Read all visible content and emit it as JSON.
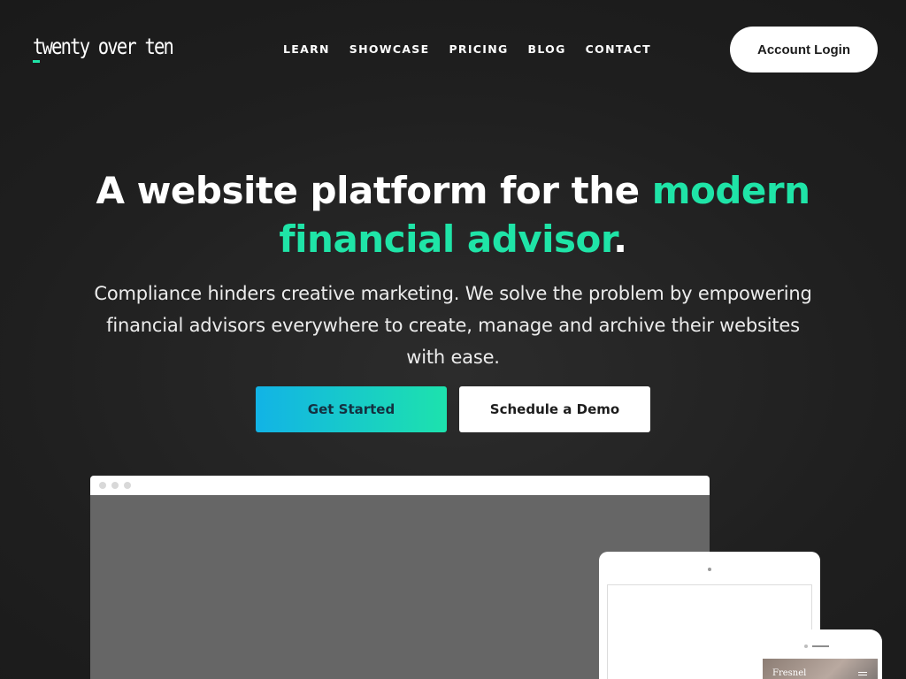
{
  "brand": {
    "logo_text": "twenty over ten",
    "accent_color": "#1fe4a7"
  },
  "nav": {
    "items": [
      {
        "label": "LEARN"
      },
      {
        "label": "SHOWCASE"
      },
      {
        "label": "PRICING"
      },
      {
        "label": "BLOG"
      },
      {
        "label": "CONTACT"
      }
    ],
    "login_label": "Account Login"
  },
  "hero": {
    "title_part1": "A website platform for the ",
    "title_accent_1": "modern",
    "title_accent_2": "financial advisor",
    "title_end": ".",
    "subtitle": "Compliance hinders creative marketing. We solve the problem by empowering financial advisors everywhere to create, manage and archive their websites with ease.",
    "primary_cta": "Get Started",
    "secondary_cta": "Schedule a Demo"
  },
  "mockup": {
    "phone_brand": "Fresnel"
  }
}
